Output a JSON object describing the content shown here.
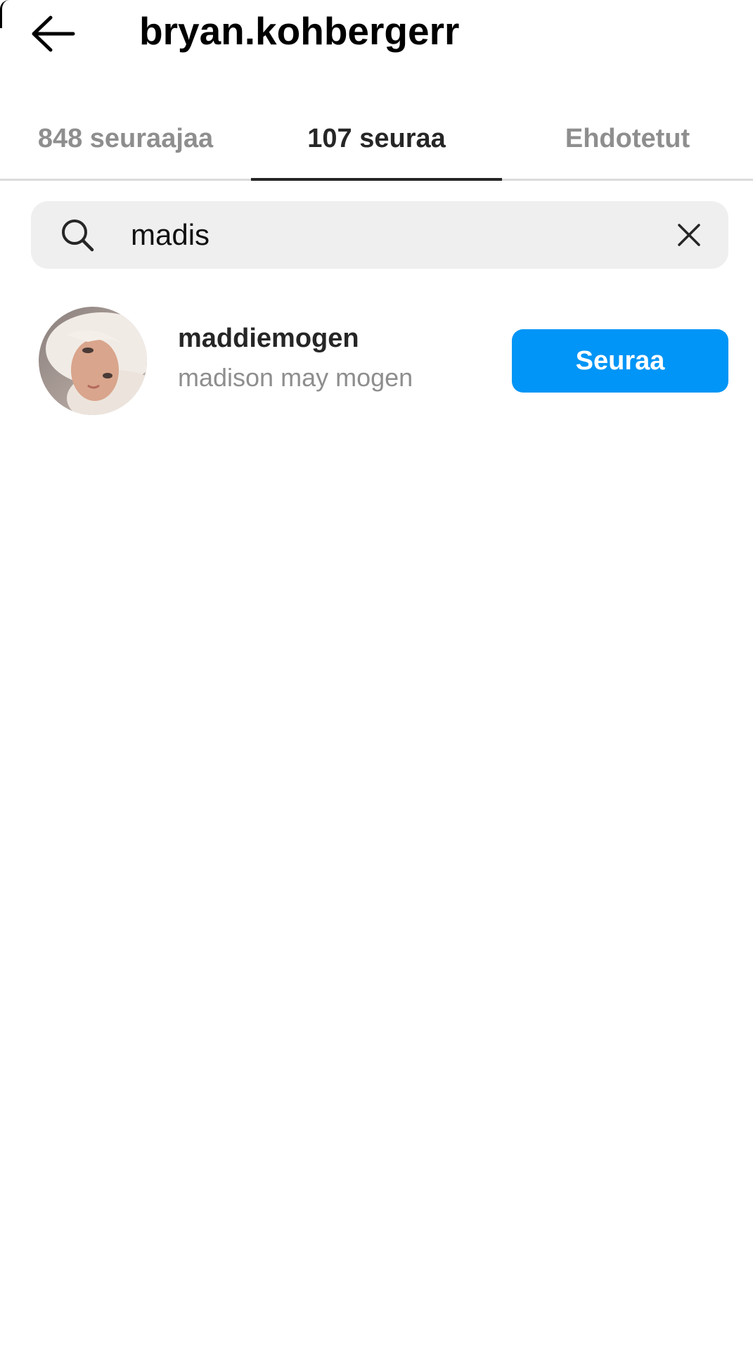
{
  "header": {
    "title": "bryan.kohbergerr",
    "back_icon": "arrow-left-icon"
  },
  "tabs": [
    {
      "label": "848 seuraajaa",
      "active": false
    },
    {
      "label": "107 seuraa",
      "active": true
    },
    {
      "label": "Ehdotetut",
      "active": false
    }
  ],
  "search": {
    "value": "madis",
    "icon": "search-icon",
    "clear_icon": "close-icon"
  },
  "results": [
    {
      "username": "maddiemogen",
      "full_name": "madison may mogen",
      "button_label": "Seuraa"
    }
  ],
  "colors": {
    "accent": "#0095f6",
    "tab_active": "#262626",
    "tab_inactive": "#8e8e8e",
    "search_bg": "#efefef"
  }
}
